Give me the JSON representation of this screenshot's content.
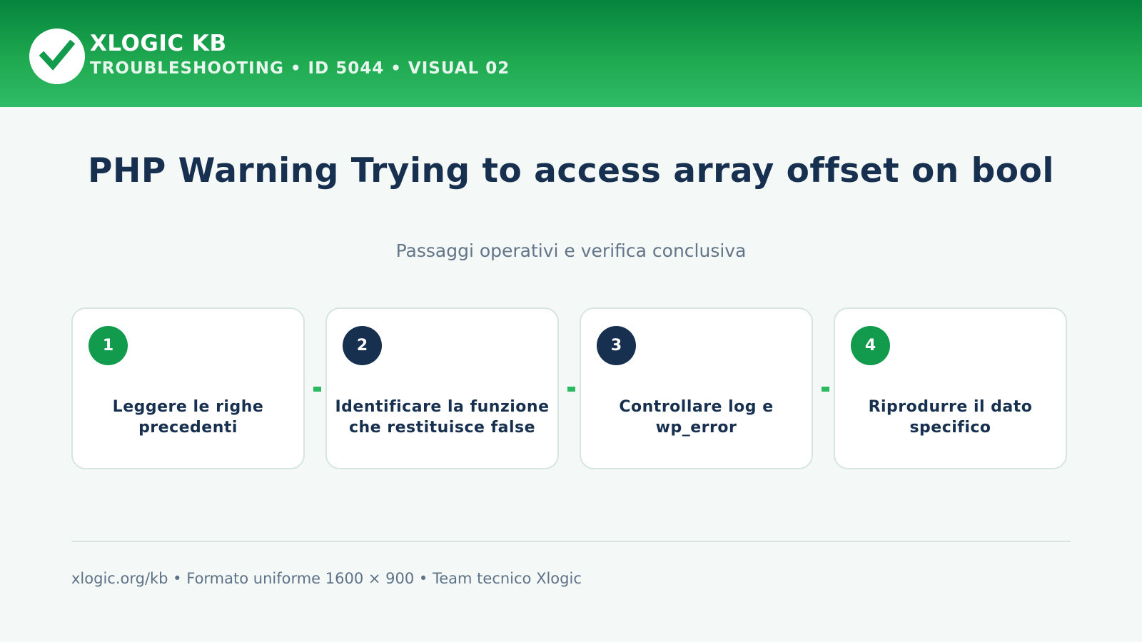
{
  "header": {
    "brand": "XLOGIC KB",
    "meta": "TROUBLESHOOTING • ID 5044 • VISUAL 02",
    "logo_icon": "checkmark-icon"
  },
  "main": {
    "title": "PHP Warning Trying to access array offset on bool",
    "subtitle": "Passaggi operativi e verifica conclusiva"
  },
  "steps": [
    {
      "number": "1",
      "label": "Leggere le righe precedenti",
      "badge_color": "#139b4d"
    },
    {
      "number": "2",
      "label": "Identificare la funzione che restituisce false",
      "badge_color": "#17304f"
    },
    {
      "number": "3",
      "label": "Controllare log e wp_error",
      "badge_color": "#17304f"
    },
    {
      "number": "4",
      "label": "Riprodurre il dato specifico",
      "badge_color": "#139b4d"
    }
  ],
  "footer": {
    "text": "xlogic.org/kb • Formato uniforme 1600 × 900 • Team tecnico Xlogic"
  },
  "colors": {
    "accent_green": "#139b4d",
    "navy": "#17304f",
    "header_green": "#1ea84f"
  }
}
